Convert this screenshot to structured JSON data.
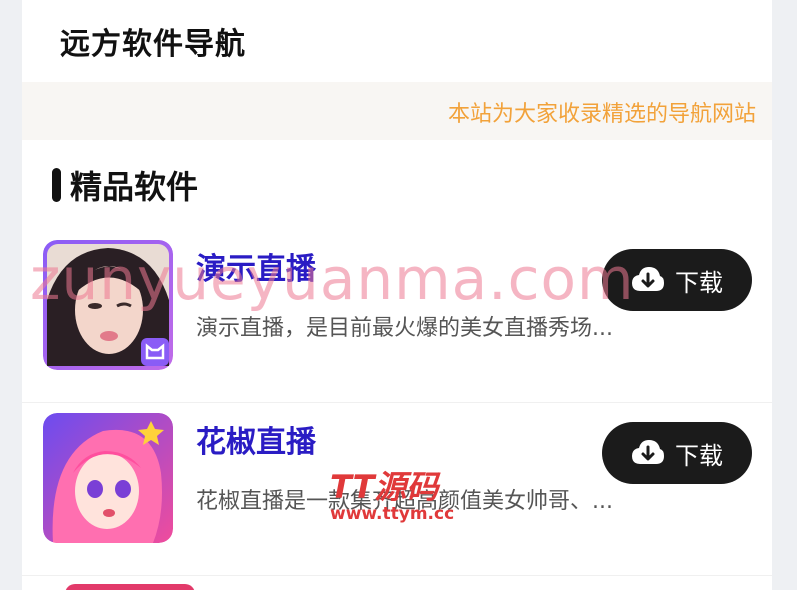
{
  "header": {
    "title": "远方软件导航"
  },
  "notice": {
    "text": "本站为大家收录精选的导航网站"
  },
  "section": {
    "title": "精品软件"
  },
  "apps": [
    {
      "name": "演示直播",
      "desc": "演示直播，是目前最火爆的美女直播秀场...",
      "button": "下载",
      "icon": "app-icon-yanshi"
    },
    {
      "name": "花椒直播",
      "desc": "花椒直播是一款集齐超高颜值美女帅哥、...",
      "button": "下载",
      "icon": "app-icon-huajiao"
    }
  ],
  "watermark": {
    "main": "zunyueyuanma.com",
    "logo": "TT源码",
    "url": "www.ttym.cc"
  },
  "colors": {
    "accent_title": "#2a1cc4",
    "notice": "#f2a23a",
    "button_bg": "#1b1b1b"
  }
}
